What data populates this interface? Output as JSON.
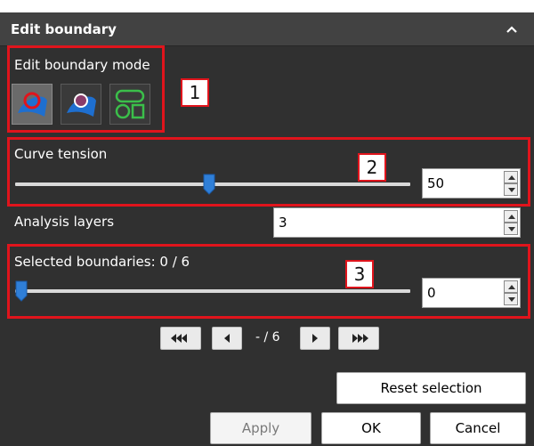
{
  "header": {
    "title": "Edit boundary"
  },
  "mode": {
    "label": "Edit boundary mode",
    "buttons": [
      "boundary-edit-red-icon",
      "boundary-edit-purple-icon",
      "shapes-green-icon"
    ]
  },
  "annotations": [
    "1",
    "2",
    "3"
  ],
  "curve_tension": {
    "label": "Curve tension",
    "value": "50",
    "slider_fraction": 0.49
  },
  "analysis_layers": {
    "label": "Analysis layers",
    "value": "3"
  },
  "selected_boundaries": {
    "label": "Selected boundaries: 0 / 6",
    "value": "0",
    "slider_fraction": 0.0
  },
  "navigation": {
    "page_text": "- / 6"
  },
  "buttons": {
    "reset": "Reset selection",
    "apply": "Apply",
    "ok": "OK",
    "cancel": "Cancel"
  },
  "colors": {
    "panel_bg": "#303030",
    "header_bg": "#424242",
    "highlight_red": "#e0141c",
    "thumb_blue": "#2f7fd8",
    "icon_green": "#3bbf4a"
  }
}
